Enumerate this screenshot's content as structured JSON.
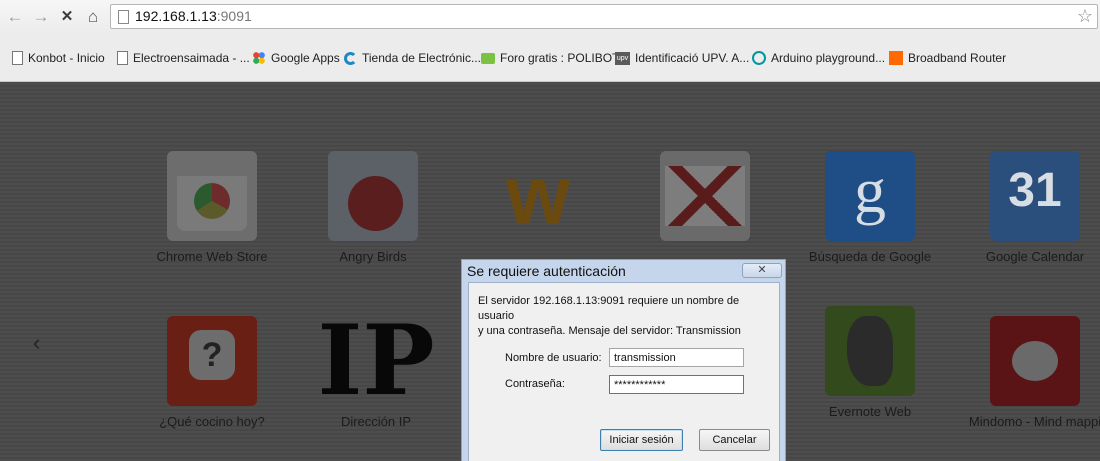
{
  "browser": {
    "url_host": "192.168.1.13",
    "url_port": ":9091",
    "back_icon": "arrow-left",
    "forward_icon": "arrow-right",
    "stop_icon": "x",
    "home_icon": "home",
    "star_icon": "star"
  },
  "bookmarks": [
    {
      "label": "Konbot - Inicio",
      "icon": "page-icon"
    },
    {
      "label": "Electroensaimada - ...",
      "icon": "page-icon"
    },
    {
      "label": "Google Apps",
      "icon": "google-apps-icon"
    },
    {
      "label": "Tienda de Electrónic...",
      "icon": "tienda-icon"
    },
    {
      "label": "Foro gratis : POLIBOT",
      "icon": "speech-bubble-icon"
    },
    {
      "label": "Identificació UPV. A...",
      "icon": "upv-icon"
    },
    {
      "label": "Arduino playground...",
      "icon": "arduino-icon"
    },
    {
      "label": "Broadband Router",
      "icon": "orange-square-icon"
    }
  ],
  "apps_row1": [
    {
      "label": "Chrome Web Store"
    },
    {
      "label": "Angry Birds"
    },
    {
      "label": ""
    },
    {
      "label": ""
    },
    {
      "label": "Búsqueda de Google",
      "glyph": "g"
    },
    {
      "label": "Google Calendar",
      "glyph": "31"
    }
  ],
  "apps_row2": [
    {
      "label": "¿Qué cocino hoy?"
    },
    {
      "label": "Dirección IP",
      "glyph": "IP"
    },
    {
      "label": "Evernote Web"
    },
    {
      "label": "Mindomo - Mind mappi"
    }
  ],
  "w_glyph": "w",
  "pager_left": "‹",
  "dialog": {
    "title": "Se requiere autenticación",
    "close_label": "✕",
    "message_line1": "El servidor 192.168.1.13:9091 requiere un nombre de usuario",
    "message_line2": "y una contraseña. Mensaje del servidor: Transmission",
    "username_label": "Nombre de usuario:",
    "username_value": "transmission",
    "password_label": "Contraseña:",
    "password_value": "************",
    "login_button": "Iniciar sesión",
    "cancel_button": "Cancelar"
  }
}
